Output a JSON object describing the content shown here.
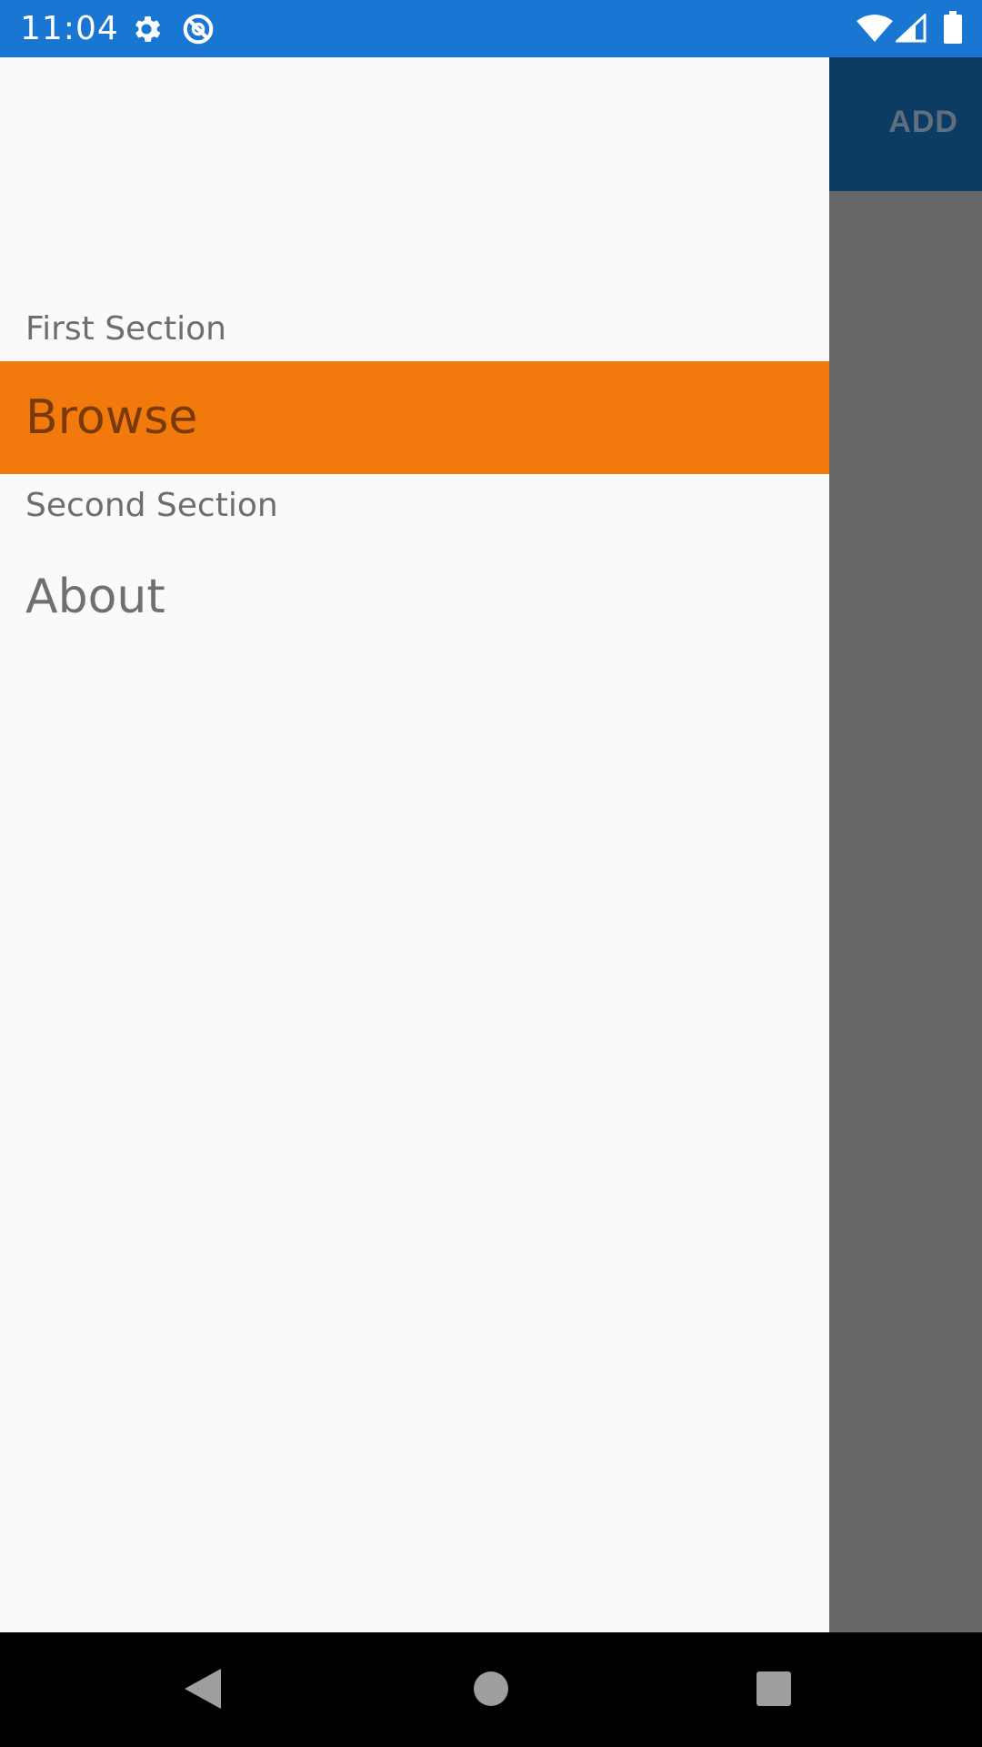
{
  "status_bar": {
    "time": "11:04",
    "icons": [
      "gear-icon",
      "do-not-disturb-icon",
      "wifi-icon",
      "signal-icon",
      "battery-icon"
    ],
    "background_color": "#1976d2"
  },
  "toolbar": {
    "add_label": "ADD",
    "color": "#0c3b63"
  },
  "drawer": {
    "sections": [
      {
        "title": "First Section",
        "items": [
          {
            "label": "Browse",
            "selected": true
          }
        ]
      },
      {
        "title": "Second Section",
        "items": [
          {
            "label": "About",
            "selected": false
          }
        ]
      }
    ],
    "selected_color": "#f27a0c"
  },
  "nav_bar": {
    "buttons": [
      "back-icon",
      "home-icon",
      "recents-icon"
    ]
  }
}
